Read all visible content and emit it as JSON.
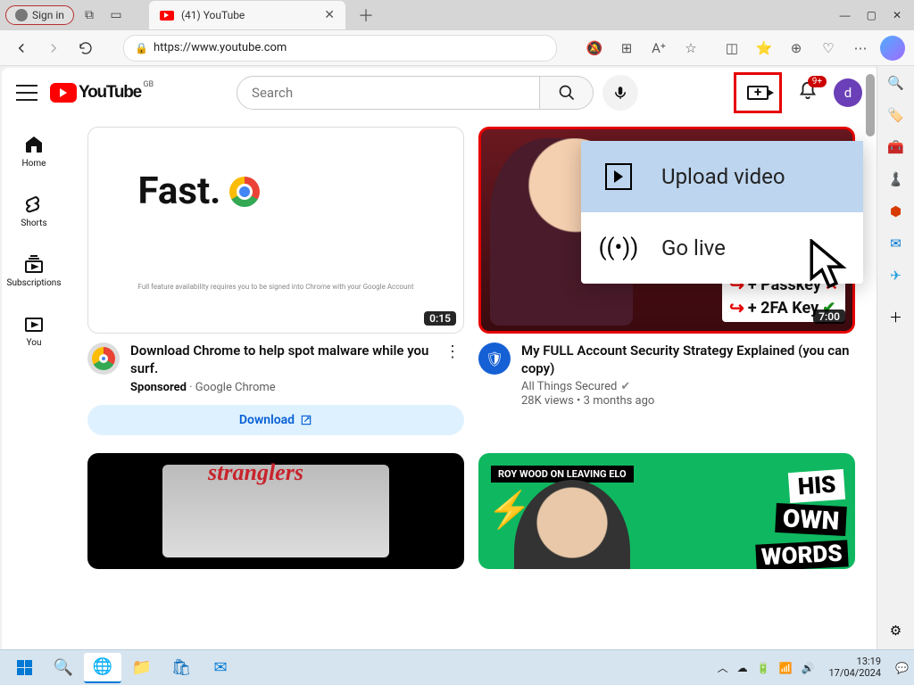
{
  "browser": {
    "signin": "Sign in",
    "tab_title": "(41) YouTube",
    "url": "https://www.youtube.com"
  },
  "youtube": {
    "region": "GB",
    "logo_text": "YouTube",
    "search_placeholder": "Search",
    "notifications_badge": "9+",
    "avatar_letter": "d",
    "nav": {
      "home": "Home",
      "shorts": "Shorts",
      "subscriptions": "Subscriptions",
      "you": "You"
    },
    "create_menu": {
      "upload": "Upload video",
      "golive": "Go live"
    },
    "feed": [
      {
        "thumb_headline": "Fast.",
        "thumb_disclaimer": "Full feature availability requires you to be signed into Chrome with your Google Account",
        "duration": "0:15",
        "title": "Download Chrome to help spot malware while you surf.",
        "sponsored_label": "Sponsored",
        "sponsor": "Google Chrome",
        "download_btn": "Download"
      },
      {
        "sec_line1": "+ Passkey",
        "sec_line2": "+ 2FA Key",
        "duration": "7:00",
        "title": "My FULL Account Security Strategy Explained (you can copy)",
        "channel": "All Things Secured",
        "views": "28K views",
        "age": "3 months ago"
      },
      {
        "thumb_overlay": "ROY WOOD ON LEAVING ELO",
        "big1": "HIS",
        "big2": "OWN",
        "big3": "WORDS"
      }
    ]
  },
  "taskbar": {
    "time": "13:19",
    "date": "17/04/2024"
  }
}
